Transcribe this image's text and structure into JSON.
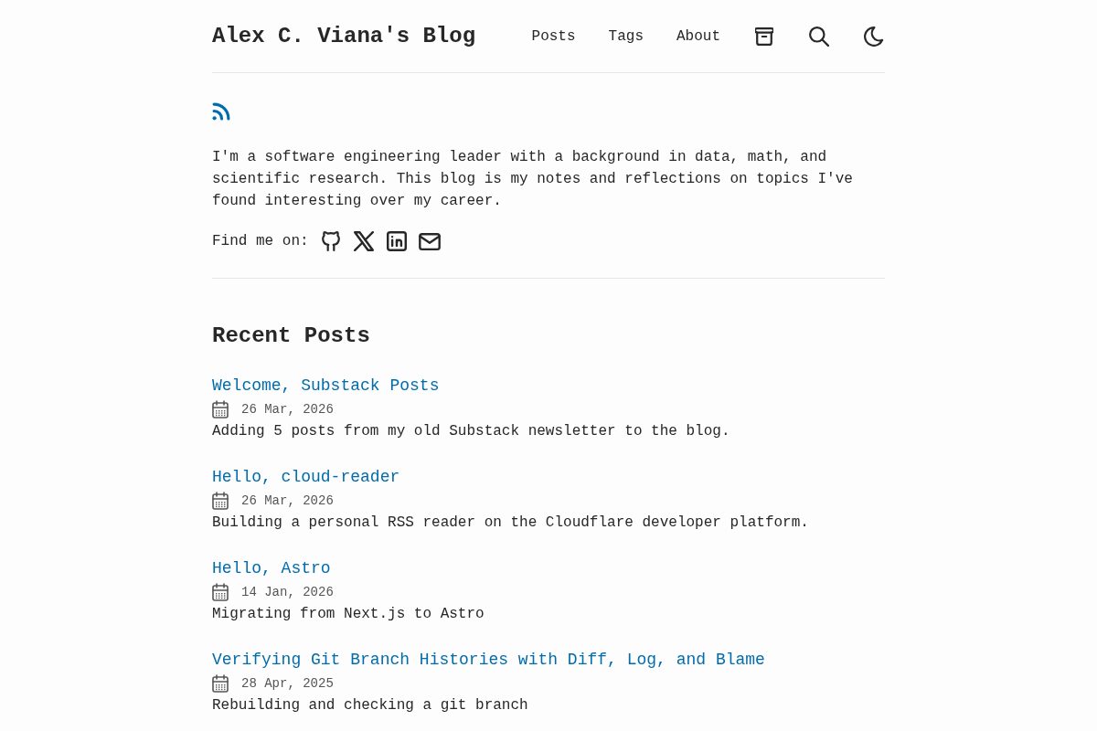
{
  "header": {
    "site_title": "Alex C. Viana's Blog",
    "nav": [
      {
        "label": "Posts"
      },
      {
        "label": "Tags"
      },
      {
        "label": "About"
      }
    ]
  },
  "intro": {
    "paragraph": "I'm a software engineering leader with a background in data, math, and scientific research. This blog is my notes and reflections on topics I've found interesting over my career.",
    "find_me_label": "Find me on:"
  },
  "recent_posts": {
    "heading": "Recent Posts",
    "posts": [
      {
        "title": "Welcome, Substack Posts",
        "date": "26 Mar, 2026",
        "description": "Adding 5 posts from my old Substack newsletter to the blog."
      },
      {
        "title": "Hello, cloud-reader",
        "date": "26 Mar, 2026",
        "description": "Building a personal RSS reader on the Cloudflare developer platform."
      },
      {
        "title": "Hello, Astro",
        "date": "14 Jan, 2026",
        "description": "Migrating from Next.js to Astro"
      },
      {
        "title": "Verifying Git Branch Histories with Diff, Log, and Blame",
        "date": "28 Apr, 2025",
        "description": "Rebuilding and checking a git branch"
      }
    ]
  }
}
